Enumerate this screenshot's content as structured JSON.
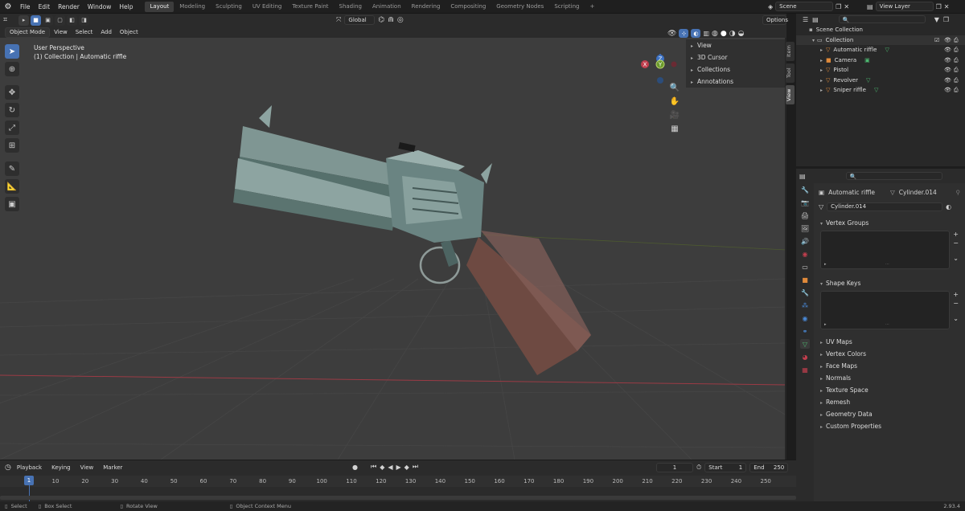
{
  "topbar": {
    "menus": [
      "File",
      "Edit",
      "Render",
      "Window",
      "Help"
    ],
    "workspaces": [
      "Layout",
      "Modeling",
      "Sculpting",
      "UV Editing",
      "Texture Paint",
      "Shading",
      "Animation",
      "Rendering",
      "Compositing",
      "Geometry Nodes",
      "Scripting"
    ],
    "active_workspace": "Layout",
    "add_tab": "+",
    "scene": "Scene",
    "view_layer": "View Layer"
  },
  "viewport_header": {
    "mode": "Object Mode",
    "menus": [
      "View",
      "Select",
      "Add",
      "Object"
    ],
    "orientation": "Global",
    "options": "Options"
  },
  "viewport": {
    "perspective": "User Perspective",
    "collection_info": "(1) Collection | Automatic riffle",
    "gizmo": {
      "x": "X",
      "y": "Y",
      "z": "Z"
    },
    "npanel_items": [
      "View",
      "3D Cursor",
      "Collections",
      "Annotations"
    ],
    "side_tabs": [
      "Item",
      "Tool",
      "View"
    ]
  },
  "timeline": {
    "menus": [
      "Playback",
      "Keying",
      "View",
      "Marker"
    ],
    "current_frame": "1",
    "start_label": "Start",
    "start": "1",
    "end_label": "End",
    "end": "250",
    "ruler": [
      "10",
      "20",
      "30",
      "40",
      "50",
      "60",
      "70",
      "80",
      "90",
      "100",
      "110",
      "120",
      "130",
      "140",
      "150",
      "160",
      "170",
      "180",
      "190",
      "200",
      "210",
      "220",
      "230",
      "240",
      "250"
    ],
    "playhead": "1"
  },
  "statusbar": {
    "select": "Select",
    "box_select": "Box Select",
    "rotate": "Rotate View",
    "context": "Object Context Menu",
    "version": "2.93.4"
  },
  "outliner": {
    "root": "Scene Collection",
    "collection": "Collection",
    "items": [
      "Automatic riffle",
      "Camera",
      "Pistol",
      "Revolver",
      "Sniper riffle"
    ]
  },
  "properties": {
    "object": "Automatic riffle",
    "mesh": "Cylinder.014",
    "data_name": "Cylinder.014",
    "sections": {
      "vertex_groups": "Vertex Groups",
      "shape_keys": "Shape Keys",
      "closed": [
        "UV Maps",
        "Vertex Colors",
        "Face Maps",
        "Normals",
        "Texture Space",
        "Remesh",
        "Geometry Data",
        "Custom Properties"
      ]
    }
  },
  "colors": {
    "accent": "#4772b3",
    "axis_x": "#c13e4d",
    "axis_y": "#6b9a2c",
    "axis_z": "#3d72c4",
    "background": "#3d3d3d"
  }
}
